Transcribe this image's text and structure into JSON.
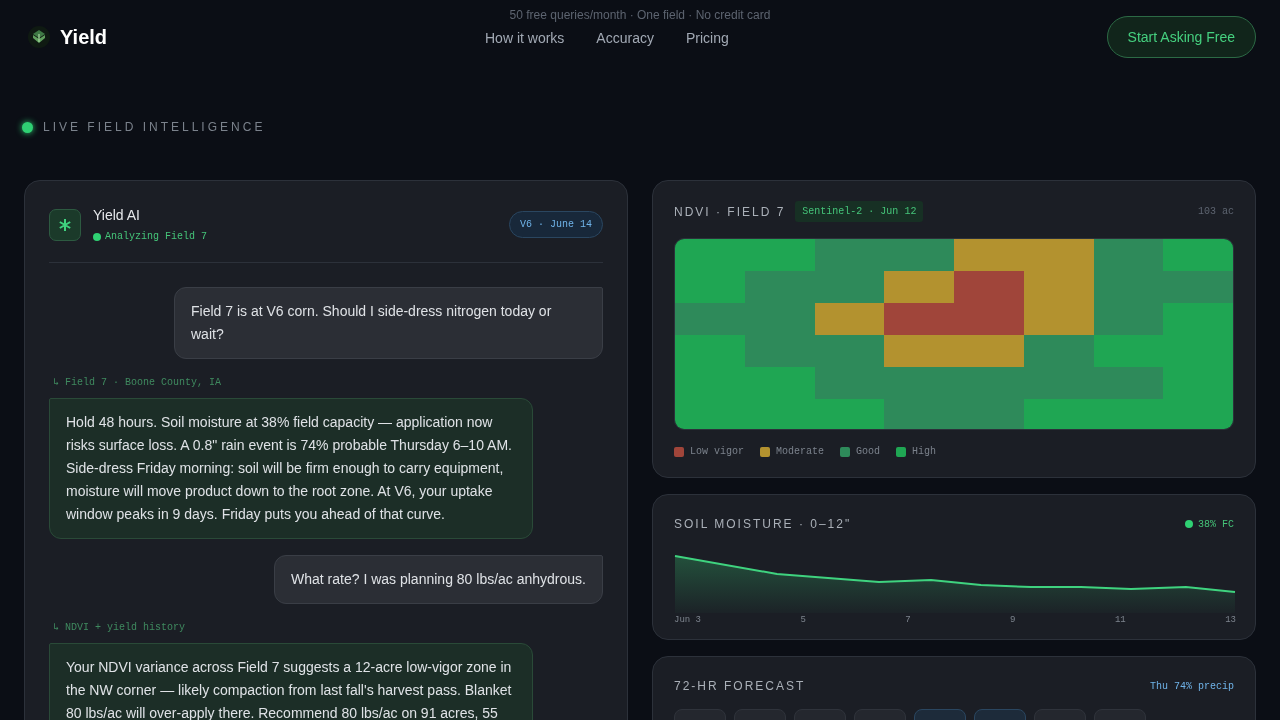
{
  "header": {
    "brand": "Yield",
    "tagline": "50 free queries/month · One field · No credit card",
    "nav": [
      "How it works",
      "Accuracy",
      "Pricing"
    ],
    "cta": "Start Asking Free"
  },
  "eyebrow": "LIVE FIELD INTELLIGENCE",
  "chat": {
    "name": "Yield AI",
    "status": "Analyzing Field 7",
    "badge": "V6 · June 14",
    "messages": [
      {
        "kind": "user",
        "text": "Field 7 is at V6 corn. Should I side-dress nitrogen today or wait?"
      },
      {
        "kind": "ai",
        "source": "↳ Field 7 · Boone County, IA",
        "text": "Hold 48 hours. Soil moisture at 38% field capacity — application now risks surface loss. A 0.8\" rain event is 74% probable Thursday 6–10 AM. Side-dress Friday morning: soil will be firm enough to carry equipment, moisture will move product down to the root zone. At V6, your uptake window peaks in 9 days. Friday puts you ahead of that curve."
      },
      {
        "kind": "user",
        "text": "What rate? I was planning 80 lbs/ac anhydrous."
      },
      {
        "kind": "ai",
        "source": "↳ NDVI + yield history",
        "text": "Your NDVI variance across Field 7 suggests a 12-acre low-vigor zone in the NW corner — likely compaction from last fall's harvest pass. Blanket 80 lbs/ac will over-apply there. Recommend 80 lbs/ac on 91 acres, 55"
      }
    ]
  },
  "ndvi": {
    "title": "NDVI · FIELD 7",
    "source": "Sentinel-2 · Jun 12",
    "area": "103 ac",
    "legend": [
      {
        "label": "Low vigor",
        "color": "#a0453a"
      },
      {
        "label": "Moderate",
        "color": "#b3922f"
      },
      {
        "label": "Good",
        "color": "#2e8a5a"
      },
      {
        "label": "High",
        "color": "#1fa653"
      }
    ],
    "grid": [
      [
        {
          "color": "#1fa653"
        },
        {
          "color": "#1fa653"
        },
        {
          "color": "#2e8a5a"
        },
        {
          "color": "#2e8a5a"
        },
        {
          "color": "#b3922f"
        },
        {
          "color": "#b3922f"
        },
        {
          "color": "#2e8a5a"
        },
        {
          "color": "#1fa653"
        }
      ],
      [
        {
          "color": "#1fa653"
        },
        {
          "color": "#2e8a5a"
        },
        {
          "color": "#2e8a5a"
        },
        {
          "color": "#b3922f"
        },
        {
          "color": "#a0453a"
        },
        {
          "color": "#b3922f"
        },
        {
          "color": "#2e8a5a"
        },
        {
          "color": "#2e8a5a"
        }
      ],
      [
        {
          "color": "#2e8a5a"
        },
        {
          "color": "#2e8a5a"
        },
        {
          "color": "#b3922f"
        },
        {
          "color": "#a0453a"
        },
        {
          "color": "#a0453a"
        },
        {
          "color": "#b3922f"
        },
        {
          "color": "#2e8a5a"
        },
        {
          "color": "#1fa653"
        }
      ],
      [
        {
          "color": "#1fa653"
        },
        {
          "color": "#2e8a5a"
        },
        {
          "color": "#2e8a5a"
        },
        {
          "color": "#b3922f"
        },
        {
          "color": "#b3922f"
        },
        {
          "color": "#2e8a5a"
        },
        {
          "color": "#1fa653"
        },
        {
          "color": "#1fa653"
        }
      ],
      [
        {
          "color": "#1fa653"
        },
        {
          "color": "#1fa653"
        },
        {
          "color": "#2e8a5a"
        },
        {
          "color": "#2e8a5a"
        },
        {
          "color": "#2e8a5a"
        },
        {
          "color": "#2e8a5a"
        },
        {
          "color": "#2e8a5a"
        },
        {
          "color": "#1fa653"
        }
      ],
      [
        {
          "color": "#1fa653"
        },
        {
          "color": "#1fa653"
        },
        {
          "color": "#1fa653"
        },
        {
          "color": "#2e8a5a"
        },
        {
          "color": "#2e8a5a"
        },
        {
          "color": "#1fa653"
        },
        {
          "color": "#1fa653"
        },
        {
          "color": "#1fa653"
        }
      ]
    ]
  },
  "moisture": {
    "title": "SOIL MOISTURE · 0–12\"",
    "reading": "38% FC",
    "x_labels": [
      "Jun 3",
      "5",
      "7",
      "9",
      "11",
      "13"
    ]
  },
  "forecast": {
    "title": "72-HR FORECAST",
    "note": "Thu 74% precip",
    "tiles": [
      {
        "rain": false
      },
      {
        "rain": false
      },
      {
        "rain": false
      },
      {
        "rain": false
      },
      {
        "rain": true
      },
      {
        "rain": true
      },
      {
        "rain": false
      },
      {
        "rain": false
      }
    ]
  }
}
